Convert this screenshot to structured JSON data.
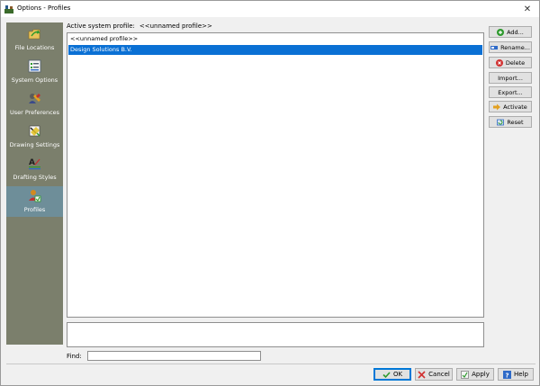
{
  "window": {
    "title": "Options - Profiles",
    "close_glyph": "✕"
  },
  "sidebar": {
    "items": [
      {
        "label": "File Locations",
        "icon": "folder-arrow-icon",
        "active": false
      },
      {
        "label": "System Options",
        "icon": "checklist-icon",
        "active": false
      },
      {
        "label": "User Preferences",
        "icon": "user-prefs-icon",
        "active": false
      },
      {
        "label": "Drawing Settings",
        "icon": "drawing-settings-icon",
        "active": false
      },
      {
        "label": "Drafting Styles",
        "icon": "drafting-styles-icon",
        "active": false
      },
      {
        "label": "Profiles",
        "icon": "profiles-icon",
        "active": true
      }
    ]
  },
  "main": {
    "active_profile_label": "Active system profile:",
    "active_profile_value": "<<unnamed profile>>",
    "profiles": [
      {
        "name": "<<unnamed profile>>",
        "selected": false
      },
      {
        "name": "Design Solutions B.V.",
        "selected": true
      }
    ],
    "find_label": "Find:",
    "find_value": ""
  },
  "actions": {
    "add": "Add...",
    "rename": "Rename...",
    "delete": "Delete",
    "import": "Import...",
    "export": "Export...",
    "activate": "Activate",
    "reset": "Reset"
  },
  "footer": {
    "ok": "OK",
    "cancel": "Cancel",
    "apply": "Apply",
    "help": "Help"
  },
  "colors": {
    "sidebar": "#7b7f6c",
    "sidebar_active": "#6e8e99",
    "selection": "#0a70d4"
  }
}
